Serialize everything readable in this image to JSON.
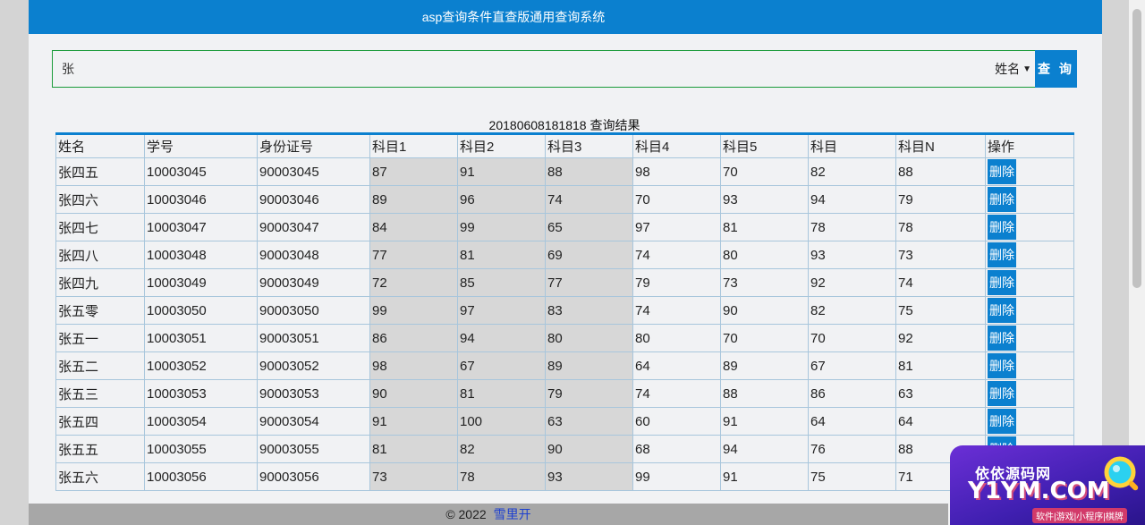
{
  "header": {
    "title": "asp查询条件直查版通用查询系统"
  },
  "search": {
    "value": "张",
    "field_selected": "姓名",
    "button_label": "查 询"
  },
  "results": {
    "caption": "20180608181818 查询结果",
    "columns": [
      "姓名",
      "学号",
      "身份证号",
      "科目1",
      "科目2",
      "科目3",
      "科目4",
      "科目5",
      "科目",
      "科目N",
      "操作"
    ],
    "delete_label": "删除",
    "rows": [
      [
        "张四五",
        "10003045",
        "90003045",
        "87",
        "91",
        "88",
        "98",
        "70",
        "82",
        "88"
      ],
      [
        "张四六",
        "10003046",
        "90003046",
        "89",
        "96",
        "74",
        "70",
        "93",
        "94",
        "79"
      ],
      [
        "张四七",
        "10003047",
        "90003047",
        "84",
        "99",
        "65",
        "97",
        "81",
        "78",
        "78"
      ],
      [
        "张四八",
        "10003048",
        "90003048",
        "77",
        "81",
        "69",
        "74",
        "80",
        "93",
        "73"
      ],
      [
        "张四九",
        "10003049",
        "90003049",
        "72",
        "85",
        "77",
        "79",
        "73",
        "92",
        "74"
      ],
      [
        "张五零",
        "10003050",
        "90003050",
        "99",
        "97",
        "83",
        "74",
        "90",
        "82",
        "75"
      ],
      [
        "张五一",
        "10003051",
        "90003051",
        "86",
        "94",
        "80",
        "80",
        "70",
        "70",
        "92"
      ],
      [
        "张五二",
        "10003052",
        "90003052",
        "98",
        "67",
        "89",
        "64",
        "89",
        "67",
        "81"
      ],
      [
        "张五三",
        "10003053",
        "90003053",
        "90",
        "81",
        "79",
        "74",
        "88",
        "86",
        "63"
      ],
      [
        "张五四",
        "10003054",
        "90003054",
        "91",
        "100",
        "63",
        "60",
        "91",
        "64",
        "64"
      ],
      [
        "张五五",
        "10003055",
        "90003055",
        "81",
        "82",
        "90",
        "68",
        "94",
        "76",
        "88"
      ],
      [
        "张五六",
        "10003056",
        "90003056",
        "73",
        "78",
        "93",
        "99",
        "91",
        "75",
        "71"
      ]
    ]
  },
  "footer": {
    "copyright": "© 2022",
    "link_text": "雪里开"
  },
  "watermark": {
    "line1": "依依源码网",
    "line2": "Y1YM.COM",
    "line3": "软件|游戏|小程序|棋牌"
  },
  "colors": {
    "primary": "#0b80cf",
    "shaded_column": "#d7d7d7",
    "search_border": "#1a9b3a"
  }
}
